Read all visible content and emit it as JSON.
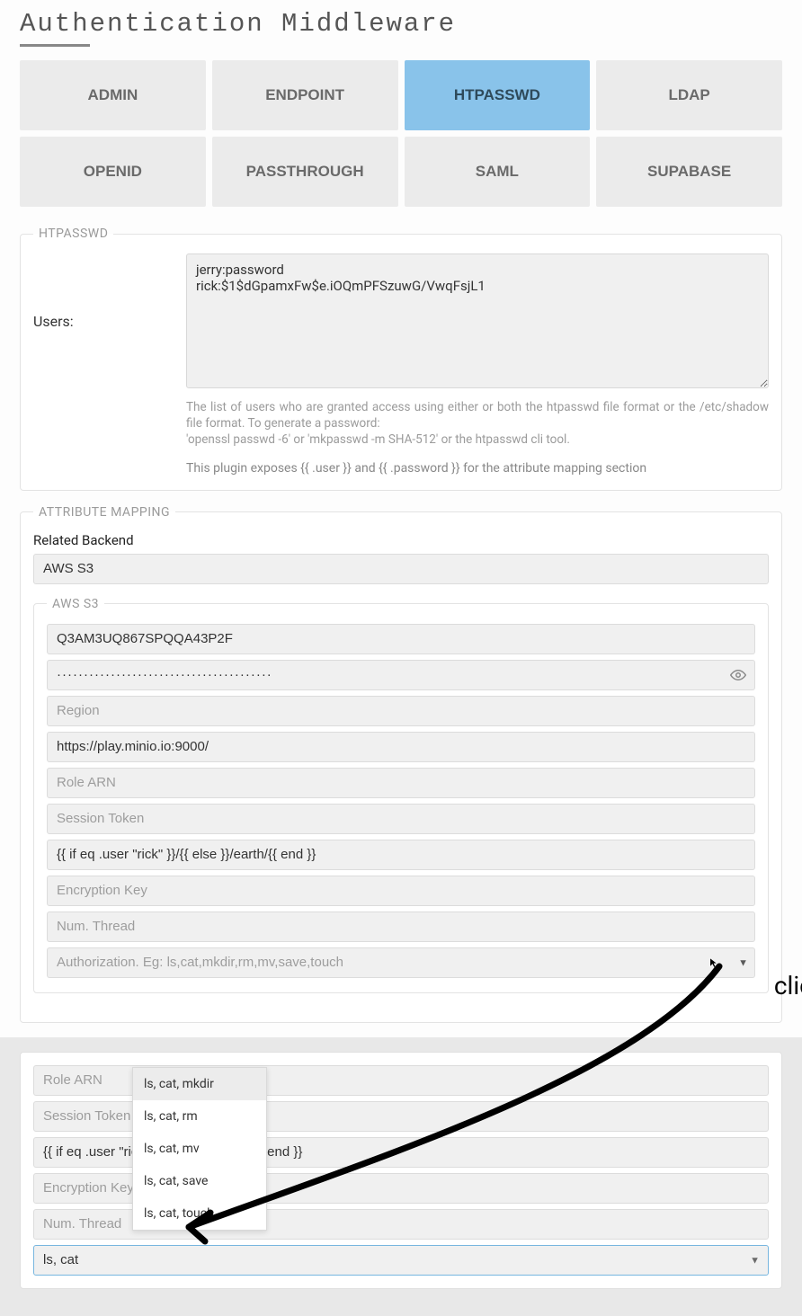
{
  "title_a": "Auth",
  "title_b": "entication Middleware",
  "tabs": [
    "ADMIN",
    "ENDPOINT",
    "HTPASSWD",
    "LDAP",
    "OPENID",
    "PASSTHROUGH",
    "SAML",
    "SUPABASE"
  ],
  "active_tab": "HTPASSWD",
  "htpasswd": {
    "legend": "HTPASSWD",
    "users_label": "Users:",
    "users_value": "jerry:password\nrick:$1$dGpamxFw$e.iOQmPFSzuwG/VwqFsjL1",
    "help1": "The list of users who are granted access using either or both the htpasswd file format or the /etc/shadow file format. To generate a password:",
    "help1b": "'openssl passwd -6' or 'mkpasswd -m SHA-512' or the htpasswd cli tool.",
    "help2": "This plugin exposes {{ .user }} and {{ .password }} for the attribute mapping section"
  },
  "attr": {
    "legend": "ATTRIBUTE MAPPING",
    "related_backend_label": "Related Backend",
    "related_backend_value": "AWS S3",
    "aws": {
      "legend": "AWS S3",
      "access_key": "Q3AM3UQ867SPQQA43P2F",
      "secret_display": "········································",
      "region_placeholder": "Region",
      "endpoint": "https://play.minio.io:9000/",
      "role_arn_placeholder": "Role ARN",
      "session_token_placeholder": "Session Token",
      "path": "{{ if eq .user \"rick\" }}/{{ else }}/earth/{{ end }}",
      "enc_key_placeholder": "Encryption Key",
      "num_thread_placeholder": "Num. Thread",
      "authorization_placeholder": "Authorization. Eg: ls,cat,mkdir,rm,mv,save,touch"
    }
  },
  "lower": {
    "role_arn_placeholder": "Role ARN",
    "session_token_placeholder": "Session Token",
    "path": "{{ if eq .user \"rick\" }}/{{ else }}/earth/{{ end }}",
    "enc_key_placeholder": "Encryption Key",
    "num_thread_placeholder": "Num. Thread",
    "authorization_value": "ls, cat",
    "options": [
      "ls, cat, mkdir",
      "ls, cat, rm",
      "ls, cat, mv",
      "ls, cat, save",
      "ls, cat, touch"
    ]
  },
  "annotation": {
    "click": "click"
  }
}
